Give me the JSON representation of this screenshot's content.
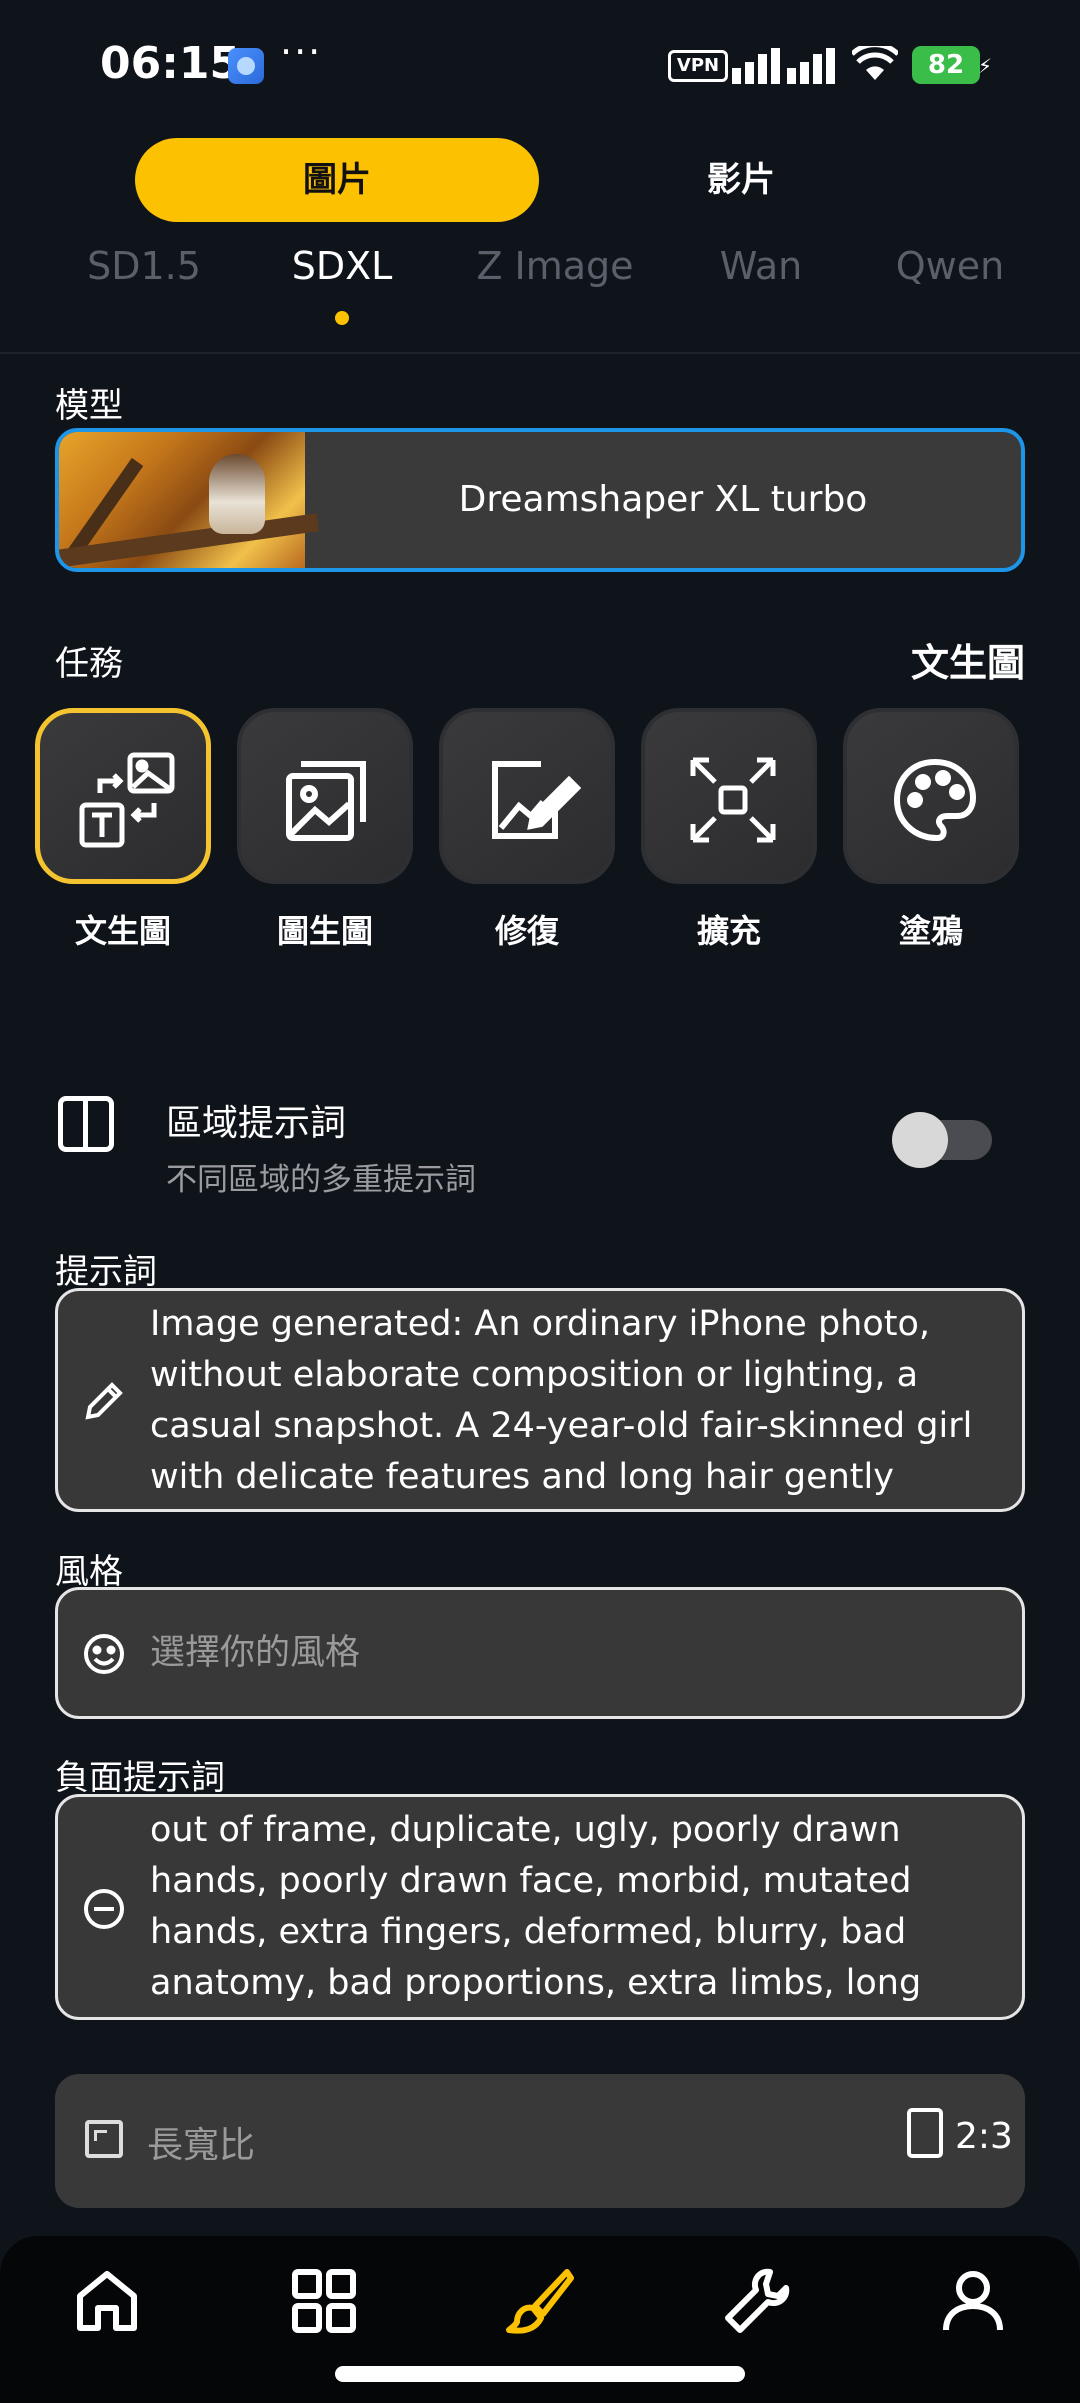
{
  "status_bar": {
    "time": "06:15",
    "dots": "···",
    "vpn": "VPN",
    "battery": "82"
  },
  "mode_toggle": {
    "image_label": "圖片",
    "video_label": "影片"
  },
  "model_tabs": [
    {
      "label": "SD1.5",
      "active": false
    },
    {
      "label": "SDXL",
      "active": true
    },
    {
      "label": "Z Image",
      "active": false
    },
    {
      "label": "Wan",
      "active": false
    },
    {
      "label": "Qwen",
      "active": false
    }
  ],
  "model_section": {
    "label": "模型",
    "model_name": "Dreamshaper XL turbo"
  },
  "task_section": {
    "label": "任務",
    "current": "文生圖",
    "tasks": [
      {
        "label": "文生圖",
        "icon": "text-to-image-icon",
        "active": true
      },
      {
        "label": "圖生圖",
        "icon": "image-to-image-icon",
        "active": false
      },
      {
        "label": "修復",
        "icon": "inpaint-icon",
        "active": false
      },
      {
        "label": "擴充",
        "icon": "outpaint-icon",
        "active": false
      },
      {
        "label": "塗鴉",
        "icon": "palette-icon",
        "active": false
      }
    ]
  },
  "regional_prompt": {
    "title": "區域提示詞",
    "subtitle": "不同區域的多重提示詞",
    "enabled": false
  },
  "prompt": {
    "label": "提示詞",
    "value": "Image generated: An ordinary iPhone photo, without elaborate composition or lighting, a casual snapshot. A 24-year-old fair-skinned girl with delicate features and long hair gently flowing in t..."
  },
  "style": {
    "label": "風格",
    "placeholder": "選擇你的風格"
  },
  "negative_prompt": {
    "label": "負面提示詞",
    "value": "out of frame, duplicate, ugly, poorly drawn hands, poorly drawn face, morbid, mutated hands, extra fingers, deformed, blurry, bad anatomy, bad proportions, extra limbs, long neck, cloned face, ..."
  },
  "aspect_ratio": {
    "label": "長寬比",
    "value": "2:3"
  },
  "bottom_nav": [
    {
      "icon": "home-icon",
      "active": false
    },
    {
      "icon": "grid-icon",
      "active": false
    },
    {
      "icon": "brush-icon",
      "active": true
    },
    {
      "icon": "wrench-icon",
      "active": false
    },
    {
      "icon": "profile-icon",
      "active": false
    }
  ],
  "colors": {
    "accent": "#fcc100",
    "model_border": "#1d95e8",
    "background": "#0f131a"
  }
}
